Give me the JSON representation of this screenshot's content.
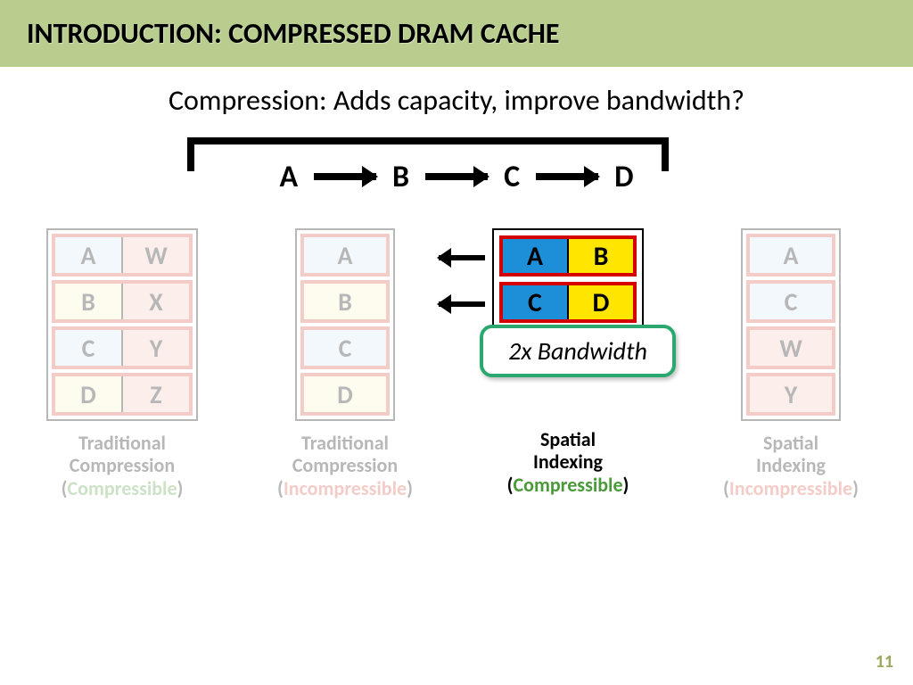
{
  "title": "INTRODUCTION: COMPRESSED DRAM CACHE",
  "subtitle": "Compression: Adds capacity, improve bandwidth?",
  "flow": {
    "a": "A",
    "b": "B",
    "c": "C",
    "d": "D"
  },
  "col1": {
    "rows": [
      [
        "A",
        "W"
      ],
      [
        "B",
        "X"
      ],
      [
        "C",
        "Y"
      ],
      [
        "D",
        "Z"
      ]
    ],
    "caption1": "Traditional",
    "caption2": "Compression",
    "tag": "Compressible"
  },
  "col2": {
    "rows": [
      "A",
      "B",
      "C",
      "D"
    ],
    "caption1": "Traditional",
    "caption2": "Compression",
    "tag": "Incompressible"
  },
  "col3": {
    "rows": [
      [
        "A",
        "B"
      ],
      [
        "C",
        "D"
      ]
    ],
    "badge": "2x Bandwidth",
    "caption1": "Spatial",
    "caption2": "Indexing",
    "tag": "Compressible"
  },
  "col4": {
    "rows": [
      "A",
      "C",
      "W",
      "Y"
    ],
    "caption1": "Spatial",
    "caption2": "Indexing",
    "tag": "Incompressible"
  },
  "slidenum": "11"
}
